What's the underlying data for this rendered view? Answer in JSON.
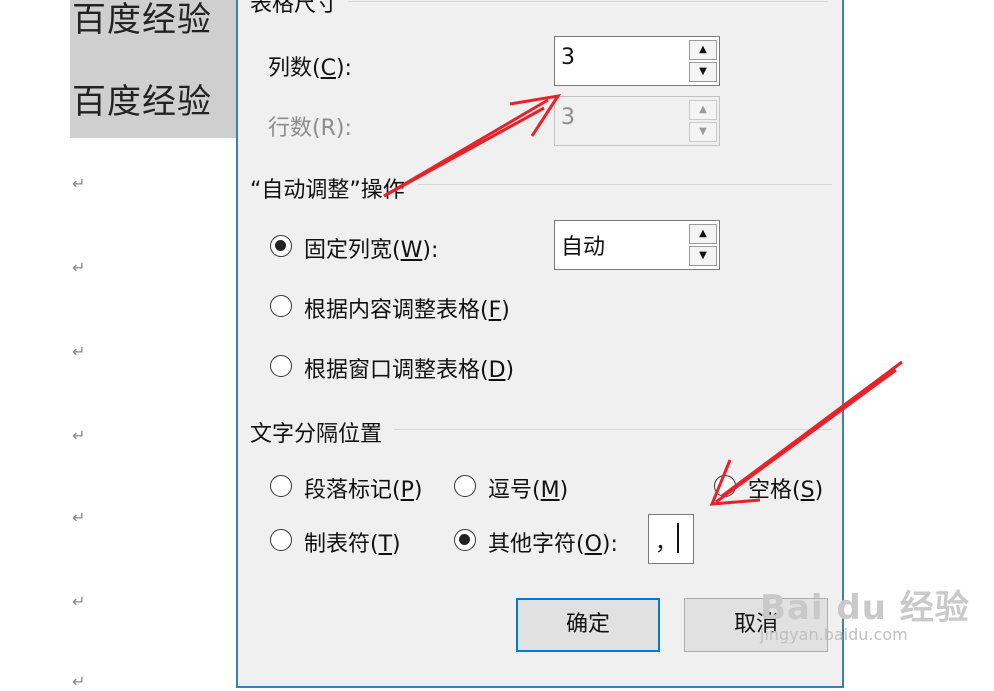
{
  "document": {
    "lines": [
      "百度经验",
      "百度经验"
    ],
    "para_mark": "↵"
  },
  "dialog": {
    "table_size": {
      "legend": "表格尺寸",
      "columns_label": "列数(",
      "columns_key": "C",
      "columns_suffix": "):",
      "columns_value": "3",
      "rows_label": "行数(R):",
      "rows_value": "3"
    },
    "autofit": {
      "legend": "“自动调整”操作",
      "fixed_label_pre": "固定列宽(",
      "fixed_key": "W",
      "fixed_label_post": "):",
      "fixed_value": "自动",
      "content_label_pre": "根据内容调整表格(",
      "content_key": "F",
      "window_label_pre": "根据窗口调整表格(",
      "window_key": "D",
      "close": ")"
    },
    "separator": {
      "legend": "文字分隔位置",
      "paragraph_pre": "段落标记(",
      "paragraph_key": "P",
      "comma_pre": "逗号(",
      "comma_key": "M",
      "space_pre": "空格(",
      "space_key": "S",
      "tab_pre": "制表符(",
      "tab_key": "T",
      "other_pre": "其他字符(",
      "other_key": "O",
      "other_post": "):",
      "close": ")",
      "other_value": "，"
    },
    "buttons": {
      "ok": "确定",
      "cancel": "取消"
    }
  },
  "watermark": {
    "line1": "Bai du 经验",
    "line2": "jingyan.baidu.com"
  },
  "colors": {
    "dialog_border": "#3c7fb1",
    "primary_button_border": "#0078d7",
    "arrow": "#e8222a"
  },
  "icons": {
    "spin_up": "triangle-up-icon",
    "spin_down": "triangle-down-icon",
    "annotation": "red-arrow-icon"
  }
}
